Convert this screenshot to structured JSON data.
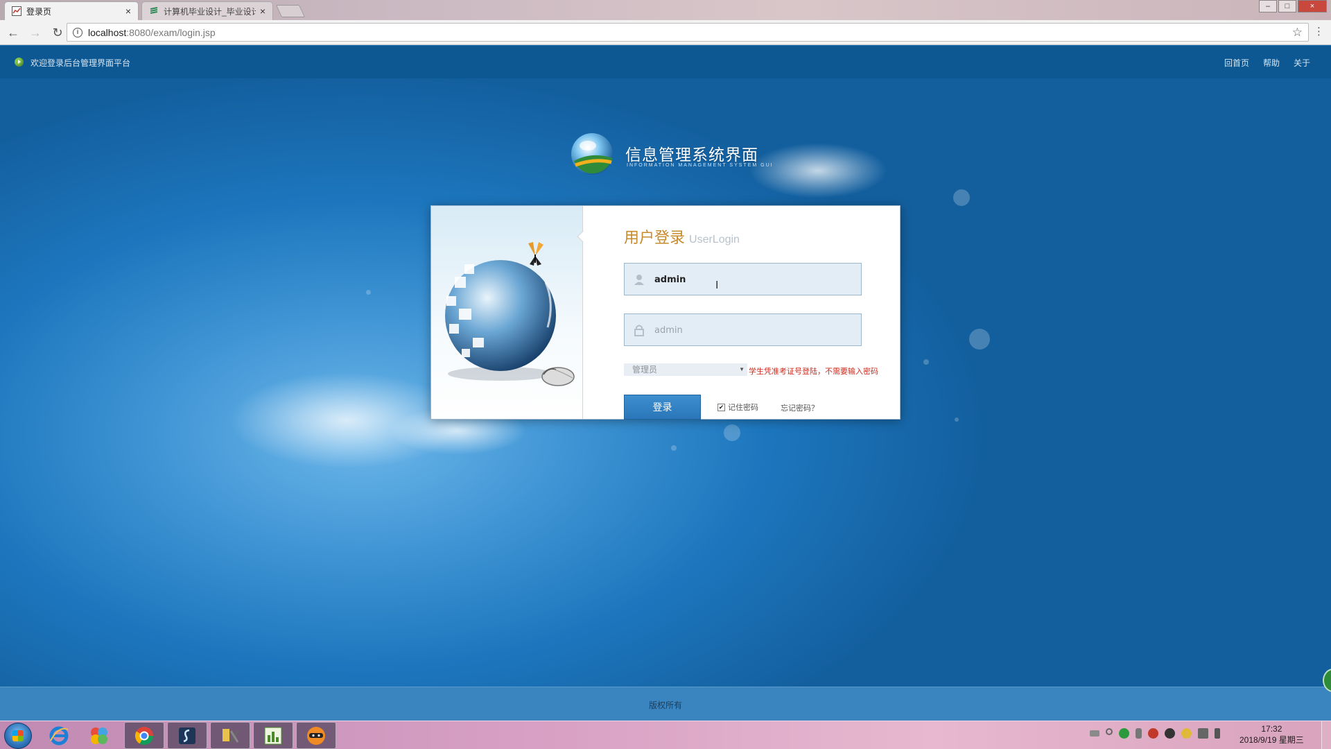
{
  "browser": {
    "tabs": [
      {
        "title": "登录页",
        "close": "×"
      },
      {
        "title": "计算机毕业设计_毕业设计",
        "close": "×"
      }
    ],
    "window_controls": {
      "minimize": "–",
      "maximize": "□",
      "close": "×"
    },
    "url_host": "localhost",
    "url_path": ":8080/exam/login.jsp",
    "back": "←",
    "forward": "→",
    "reload": "↻",
    "star": "☆",
    "menu": "⋮"
  },
  "topbar": {
    "welcome": "欢迎登录后台管理界面平台",
    "nav": [
      "回首页",
      "帮助",
      "关于"
    ]
  },
  "logo": {
    "title": "信息管理系统界面",
    "subtitle": "INFORMATION MANAGEMENT SYSTEM GUI"
  },
  "login": {
    "title_zh": "用户登录",
    "title_en": "UserLogin",
    "username_value": "admin",
    "password_placeholder": "admin",
    "role_selected": "管理员",
    "role_hint": "学生凭准考证号登陆，不需要输入密码",
    "submit_label": "登录",
    "remember_label": "记住密码",
    "remember_checked": true,
    "forgot_label": "忘记密码？"
  },
  "footer": {
    "copyright": "版权所有"
  },
  "taskbar": {
    "clock_time": "17:32",
    "clock_date": "2018/9/19 星期三"
  },
  "colors": {
    "accent_gold": "#c78a2c",
    "hint_red": "#d02b1e",
    "button_blue": "#2b76b8",
    "topbar": "#0d5892"
  }
}
